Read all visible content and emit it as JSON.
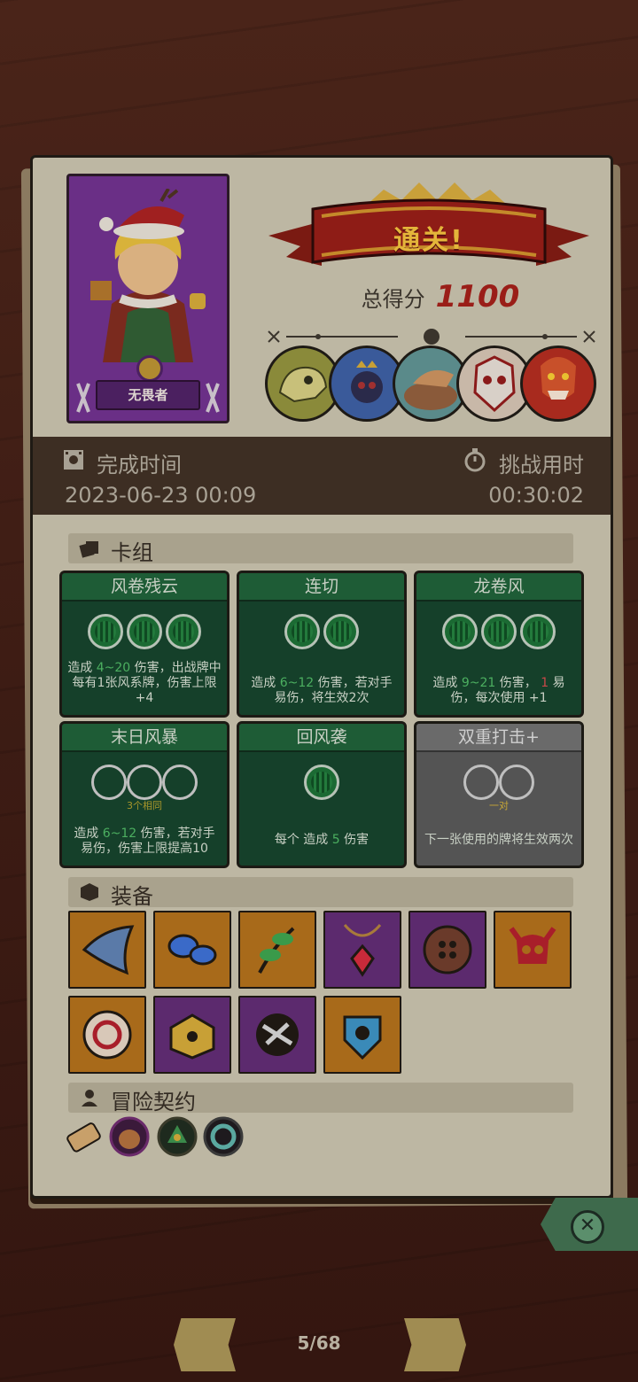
{
  "hero": {
    "name": "无畏者"
  },
  "result": {
    "banner": "通关!",
    "score_label": "总得分",
    "score_value": "1100"
  },
  "bosses": [
    "dino-skeleton-boss",
    "crown-spider-boss",
    "turtle-dragon-boss",
    "mask-demon-boss",
    "fire-beast-boss"
  ],
  "times": {
    "completion_label": "完成时间",
    "completion_value": "2023-06-23 00:09",
    "challenge_label": "挑战用时",
    "challenge_value": "00:30:02"
  },
  "sections": {
    "deck": "卡组",
    "equipment": "装备",
    "contract": "冒险契约"
  },
  "cards": [
    {
      "title": "风卷残云",
      "desc": [
        "造成 ",
        "4~20",
        " 伤害，出战牌中每有1张风系牌，伤害上限+4"
      ],
      "orbs": 3
    },
    {
      "title": "连切",
      "desc": [
        "造成 ",
        "6~12",
        " 伤害，若对手 易伤，将生效2次"
      ],
      "orbs": 2
    },
    {
      "title": "龙卷风",
      "desc": [
        "造成 ",
        "9~21",
        " 伤害， ",
        "1",
        " 易伤，每次使用 +1"
      ],
      "orbs": 3
    },
    {
      "title": "末日风暴",
      "sub": "3个相同",
      "desc": [
        "造成 ",
        "6~12",
        " 伤害，若对手 易伤，伤害上限提高10"
      ]
    },
    {
      "title": "回风袭",
      "desc": [
        "每个  造成 ",
        "5",
        " 伤害"
      ]
    },
    {
      "title": "双重打击+",
      "sub": "一对",
      "desc": "下一张使用的牌将生效两次"
    }
  ],
  "equipment_icons": [
    "horn-icon",
    "blue-mushroom-icon",
    "green-herb-icon",
    "red-gem-necklace-icon",
    "button-icon",
    "red-skull-icon",
    "ring-shield-icon",
    "golden-chest-icon",
    "cracked-orb-icon",
    "blue-crest-icon"
  ],
  "contract_icons": [
    "scroll-icon",
    "pot-icon",
    "star-badge-icon",
    "teal-ring-icon"
  ],
  "pager": {
    "label": "5/68"
  }
}
